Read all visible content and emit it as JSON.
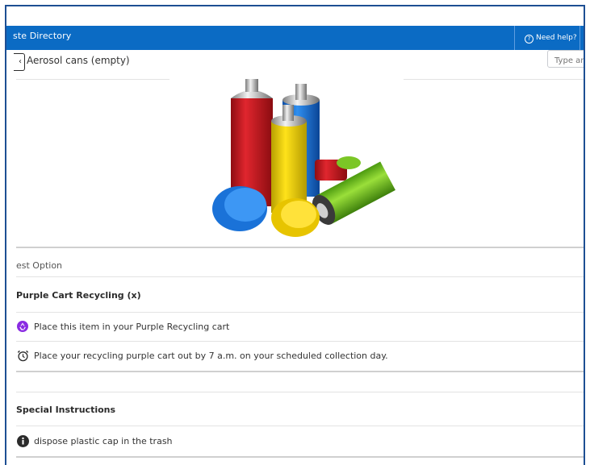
{
  "header": {
    "title": "ste Directory",
    "help_label": "Need help?"
  },
  "search": {
    "placeholder": "Type an"
  },
  "item": {
    "back_glyph": "‹",
    "title": "Aerosol cans (empty)"
  },
  "best_option": {
    "label": "est Option",
    "option_title": "Purple Cart Recycling (x)",
    "instructions": [
      {
        "icon": "recycle-icon",
        "text": "Place this item in your Purple Recycling cart"
      },
      {
        "icon": "alarm-clock-icon",
        "text": "Place your recycling purple cart out by 7 a.m. on your scheduled collection day."
      }
    ]
  },
  "special": {
    "title": "Special Instructions",
    "instructions": [
      {
        "icon": "info-icon",
        "text": "dispose plastic cap in the trash"
      }
    ]
  },
  "colors": {
    "header_bg": "#0b6bc4",
    "frame_border": "#1e4f93",
    "recycle_purple": "#8a2be2"
  }
}
